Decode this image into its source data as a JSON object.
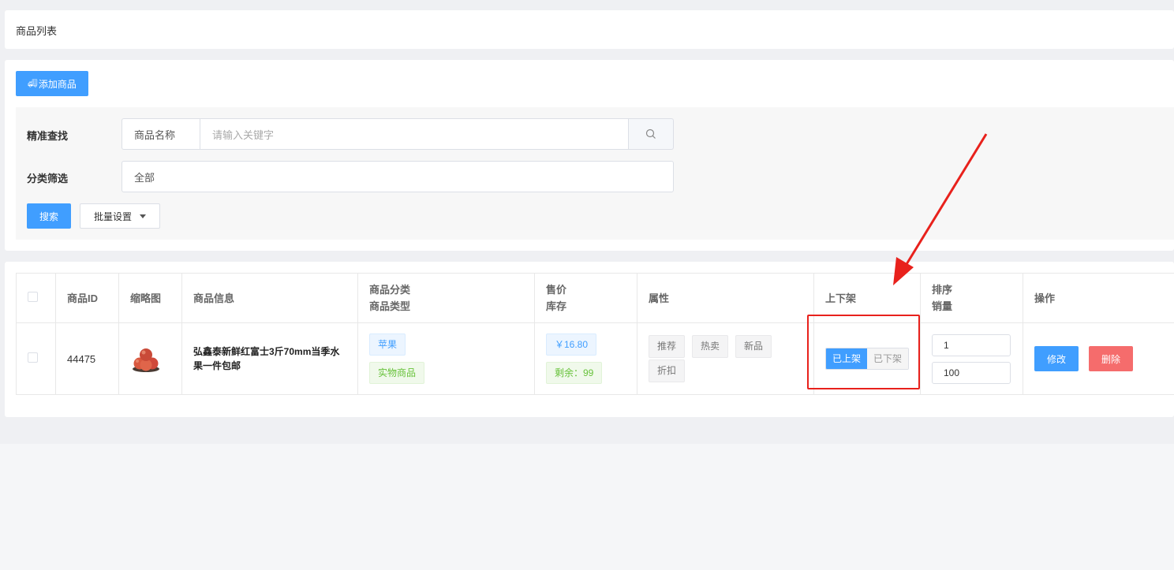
{
  "page_title": "商品列表",
  "toolbar": {
    "add_label": "添加商品",
    "add_icon": "truck-icon"
  },
  "filter": {
    "exact_label": "精准查找",
    "field_select": "商品名称",
    "keyword_placeholder": "请输入关键字",
    "category_label": "分类筛选",
    "category_value": "全部",
    "search_label": "搜索",
    "batch_label": "批量设置"
  },
  "table": {
    "headers": {
      "id": "商品ID",
      "thumb": "缩略图",
      "info": "商品信息",
      "cat_line1": "商品分类",
      "cat_line2": "商品类型",
      "price_line1": "售价",
      "price_line2": "库存",
      "attr": "属性",
      "shelf": "上下架",
      "sort_line1": "排序",
      "sort_line2": "销量",
      "ops": "操作"
    },
    "rows": [
      {
        "id": "44475",
        "name": "弘鑫泰新鲜红富士3斤70mm当季水果一件包邮",
        "category": "苹果",
        "type": "实物商品",
        "price": "￥16.80",
        "stock": "剩余：99",
        "attrs": [
          "推荐",
          "热卖",
          "新品",
          "折扣"
        ],
        "shelf_on": "已上架",
        "shelf_off": "已下架",
        "sort": "1",
        "sales": "100",
        "edit": "修改",
        "delete": "删除"
      }
    ]
  },
  "colors": {
    "primary": "#409eff",
    "danger": "#f56c6c",
    "annotation": "#e8211c"
  }
}
